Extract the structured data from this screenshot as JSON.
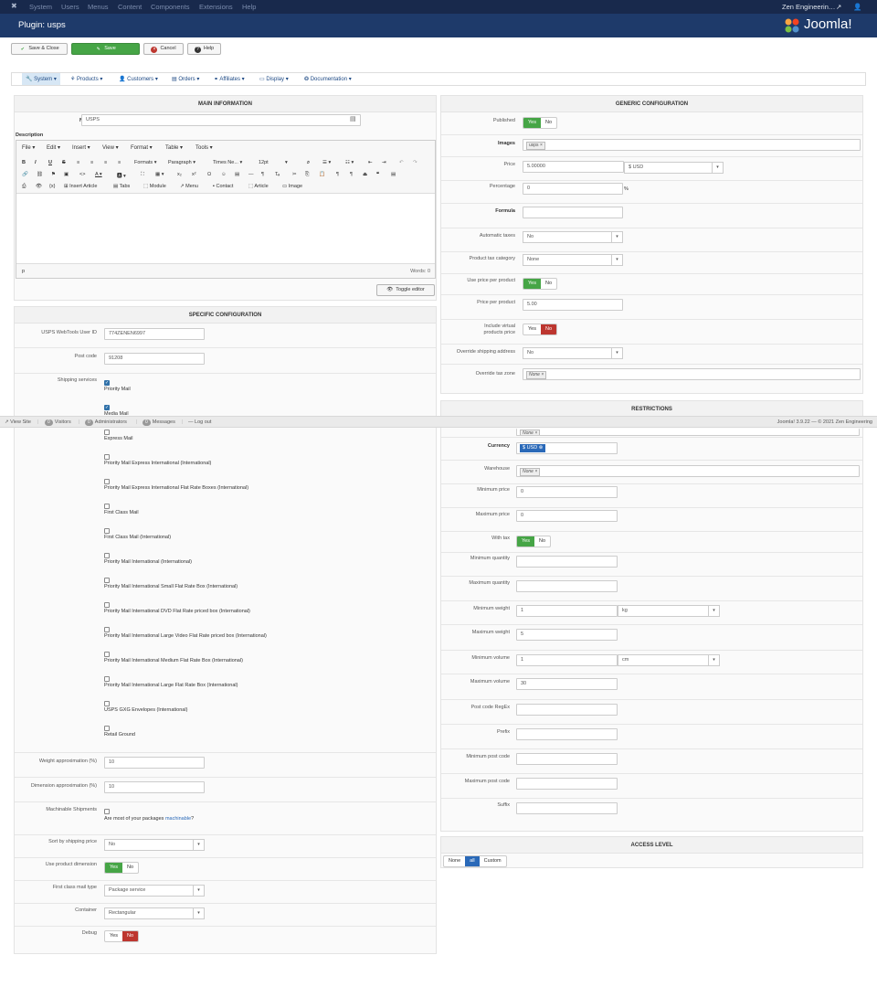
{
  "topbar": {
    "items": [
      "System",
      "Users",
      "Menus",
      "Content",
      "Components",
      "Extensions",
      "Help"
    ],
    "user": "Zen Engineerin…"
  },
  "header": {
    "title": "Plugin: usps",
    "brand": "Joomla!"
  },
  "toolbar": {
    "save_close": "Save & Close",
    "save": "Save",
    "cancel": "Cancel",
    "help": "Help"
  },
  "submenu": [
    "System",
    "Products",
    "Customers",
    "Orders",
    "Affiliates",
    "Display",
    "Documentation"
  ],
  "main_info": {
    "heading": "MAIN INFORMATION",
    "name_label": "Name",
    "name_value": "USPS",
    "description_label": "Description",
    "editor_menus": [
      "File",
      "Edit",
      "Insert",
      "View",
      "Format",
      "Table",
      "Tools"
    ],
    "formats": "Formats",
    "paragraph": "Paragraph",
    "font": "Times Ne...",
    "size": "12pt",
    "insert_article": "Insert Article",
    "tabs": "Tabs",
    "module": "Module",
    "menu": "Menu",
    "contact": "Contact",
    "article": "Article",
    "image": "Image",
    "path": "p",
    "words": "Words: 0",
    "toggle": "Toggle editor"
  },
  "specific": {
    "heading": "SPECIFIC CONFIGURATION",
    "userid_label": "USPS WebTools User ID",
    "userid": "774ZENEN6997",
    "postcode_label": "Post code",
    "postcode": "91208",
    "services_label": "Shipping services",
    "services": [
      {
        "label": "Priority Mail",
        "checked": true
      },
      {
        "label": "Media Mail",
        "checked": true
      },
      {
        "label": "Express Mail",
        "checked": false
      },
      {
        "label": "Priority Mail Express International (International)",
        "checked": false
      },
      {
        "label": "Priority Mail Express International Flat Rate Boxes (International)",
        "checked": false
      },
      {
        "label": "First Class Mail",
        "checked": false
      },
      {
        "label": "First Class Mail (International)",
        "checked": false
      },
      {
        "label": "Priority Mail International (International)",
        "checked": false
      },
      {
        "label": "Priority Mail International Small Flat Rate Box (International)",
        "checked": false
      },
      {
        "label": "Priority Mail International DVD Flat Rate priced box (International)",
        "checked": false
      },
      {
        "label": "Priority Mail International Large Video Flat Rate priced box (International)",
        "checked": false
      },
      {
        "label": "Priority Mail International Medium Flat Rate Box (International)",
        "checked": false
      },
      {
        "label": "Priority Mail International Large Flat Rate Box (International)",
        "checked": false
      },
      {
        "label": "USPS GXG Envelopes (International)",
        "checked": false
      },
      {
        "label": "Retail Ground",
        "checked": false
      }
    ],
    "weight_label": "Weight approximation (%)",
    "weight": "10",
    "dimension_label": "Dimension approximation (%)",
    "dimension": "10",
    "machinable_label": "Machinable Shipments",
    "machinable_text": "Are most of your packages ",
    "machinable_link": "machinable",
    "machinable_q": "?",
    "sort_label": "Sort by shipping price",
    "sort_value": "No",
    "use_dim_label": "Use product dimension",
    "first_class_label": "First class mail type",
    "first_class_value": "Package service",
    "container_label": "Container",
    "container_value": "Rectangular",
    "debug_label": "Debug",
    "yes": "Yes",
    "no": "No"
  },
  "generic": {
    "heading": "GENERIC CONFIGURATION",
    "published": "Published",
    "images": "Images",
    "images_tag": "usps",
    "price": "Price",
    "price_value": "5.00000",
    "currency_value": "$ USD",
    "percentage": "Percentage",
    "percentage_value": "0",
    "percent_sign": "%",
    "formula": "Formula",
    "auto_taxes": "Automatic taxes",
    "auto_taxes_value": "No",
    "tax_category": "Product tax category",
    "tax_category_value": "None",
    "use_price_per_product": "Use price per product",
    "price_per_product": "Price per product",
    "price_per_product_value": "5.00",
    "include_virtual_1": "Include virtual",
    "include_virtual_2": "products price",
    "override_address": "Override shipping address",
    "override_address_value": "No",
    "override_tax": "Override tax zone",
    "override_tax_tag": "None",
    "yes": "Yes",
    "no": "No"
  },
  "restrictions": {
    "heading": "RESTRICTIONS",
    "partial_tag": "None",
    "currency": "Currency",
    "currency_tag": "$ USD",
    "warehouse": "Warehouse",
    "warehouse_tag": "None",
    "min_price": "Minimum price",
    "min_price_value": "0",
    "max_price": "Maximum price",
    "max_price_value": "0",
    "with_tax": "With tax",
    "min_qty": "Minimum quantity",
    "max_qty": "Maximum quantity",
    "min_weight": "Minimum weight",
    "min_weight_value": "1",
    "weight_unit": "kg",
    "max_weight": "Maximum weight",
    "max_weight_value": "5",
    "min_volume": "Minimum volume",
    "min_volume_value": "1",
    "volume_unit": "cm",
    "max_volume": "Maximum volume",
    "max_volume_value": "30",
    "postcode_regex": "Post code RegEx",
    "prefix": "Prefix",
    "min_postcode": "Minimum post code",
    "max_postcode": "Maximum post code",
    "suffix": "Suffix",
    "yes": "Yes",
    "no": "No"
  },
  "access": {
    "heading": "ACCESS LEVEL",
    "none": "None",
    "all": "all",
    "custom": "Custom"
  },
  "status": {
    "view_site": "View Site",
    "visitors_count": "0",
    "visitors": "Visitors",
    "admins_count": "0",
    "admins": "Administrators",
    "messages_count": "0",
    "messages": "Messages",
    "logout": "Log out",
    "version": "Joomla! 3.9.22 — © 2021 Zen Engineering"
  }
}
